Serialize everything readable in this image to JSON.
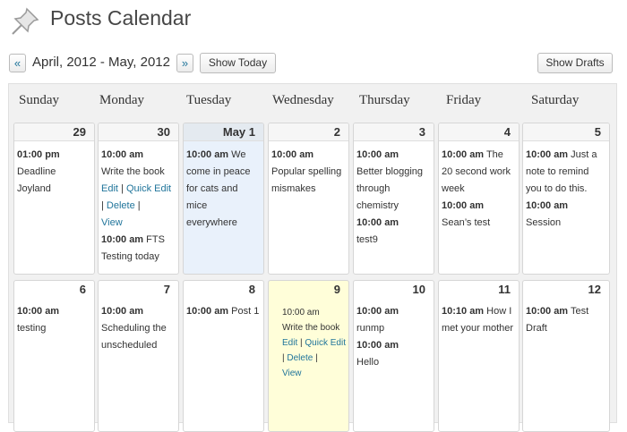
{
  "header": {
    "title": "Posts Calendar",
    "icon": "pushpin-icon"
  },
  "toolbar": {
    "prev_label": "«",
    "next_label": "»",
    "range_label": "April, 2012 - May, 2012",
    "show_today_label": "Show Today",
    "show_drafts_label": "Show Drafts"
  },
  "weekdays": [
    "Sunday",
    "Monday",
    "Tuesday",
    "Wednesday",
    "Thursday",
    "Friday",
    "Saturday"
  ],
  "action_labels": {
    "edit": "Edit",
    "sep": "|",
    "quick": "Quick",
    "edit2": "Edit",
    "delete": "Delete",
    "view": "View"
  },
  "weeks": [
    {
      "days": [
        {
          "date": "29",
          "posts": [
            {
              "time": "01:00 pm",
              "title": "Deadline Joyland"
            }
          ]
        },
        {
          "date": "30",
          "posts": [
            {
              "time": "10:00 am",
              "title": "Write the book"
            },
            {
              "time": "10:00 am",
              "title": "FTS Testing today"
            }
          ]
        },
        {
          "date": "May 1",
          "today": true,
          "posts": [
            {
              "time": "10:00 am",
              "title": "We come in peace for cats and mice everywhere"
            }
          ]
        },
        {
          "date": "2",
          "posts": [
            {
              "time": "10:00 am",
              "title": "Popular spelling mismakes"
            }
          ]
        },
        {
          "date": "3",
          "posts": [
            {
              "time": "10:00 am",
              "title": "Better blogging through chemistry"
            },
            {
              "time": "10:00 am",
              "title": "test9"
            }
          ]
        },
        {
          "date": "4",
          "posts": [
            {
              "time": "10:00 am",
              "title": "The 20 second work week"
            },
            {
              "time": "10:00 am",
              "title": "Sean’s test"
            }
          ]
        },
        {
          "date": "5",
          "posts": [
            {
              "time": "10:00 am",
              "title": "Just a note to remind you to do this."
            },
            {
              "time": "10:00 am",
              "title": "Session"
            }
          ]
        }
      ]
    },
    {
      "days": [
        {
          "date": "6",
          "posts": [
            {
              "time": "10:00 am",
              "title": "testing"
            }
          ]
        },
        {
          "date": "7",
          "posts": [
            {
              "time": "10:00 am",
              "title": "Scheduling the unscheduled"
            }
          ]
        },
        {
          "date": "8",
          "posts": [
            {
              "time": "10:00 am",
              "title": "Post 1"
            }
          ]
        },
        {
          "date": "9",
          "highlight": true,
          "posts": [
            {
              "time": "10:00 am",
              "title": "Write the book"
            }
          ]
        },
        {
          "date": "10",
          "posts": [
            {
              "time": "10:00 am",
              "title": "runmp"
            },
            {
              "time": "10:00 am",
              "title": "Hello"
            }
          ]
        },
        {
          "date": "11",
          "posts": [
            {
              "time": "10:10 am",
              "title": "How I met your mother"
            }
          ]
        },
        {
          "date": "12",
          "posts": [
            {
              "time": "10:00 am",
              "title": "Test Draft"
            }
          ]
        }
      ]
    }
  ],
  "colors": {
    "link": "#21759b",
    "today": "#e9f1fb",
    "highlight": "#fffed9"
  }
}
